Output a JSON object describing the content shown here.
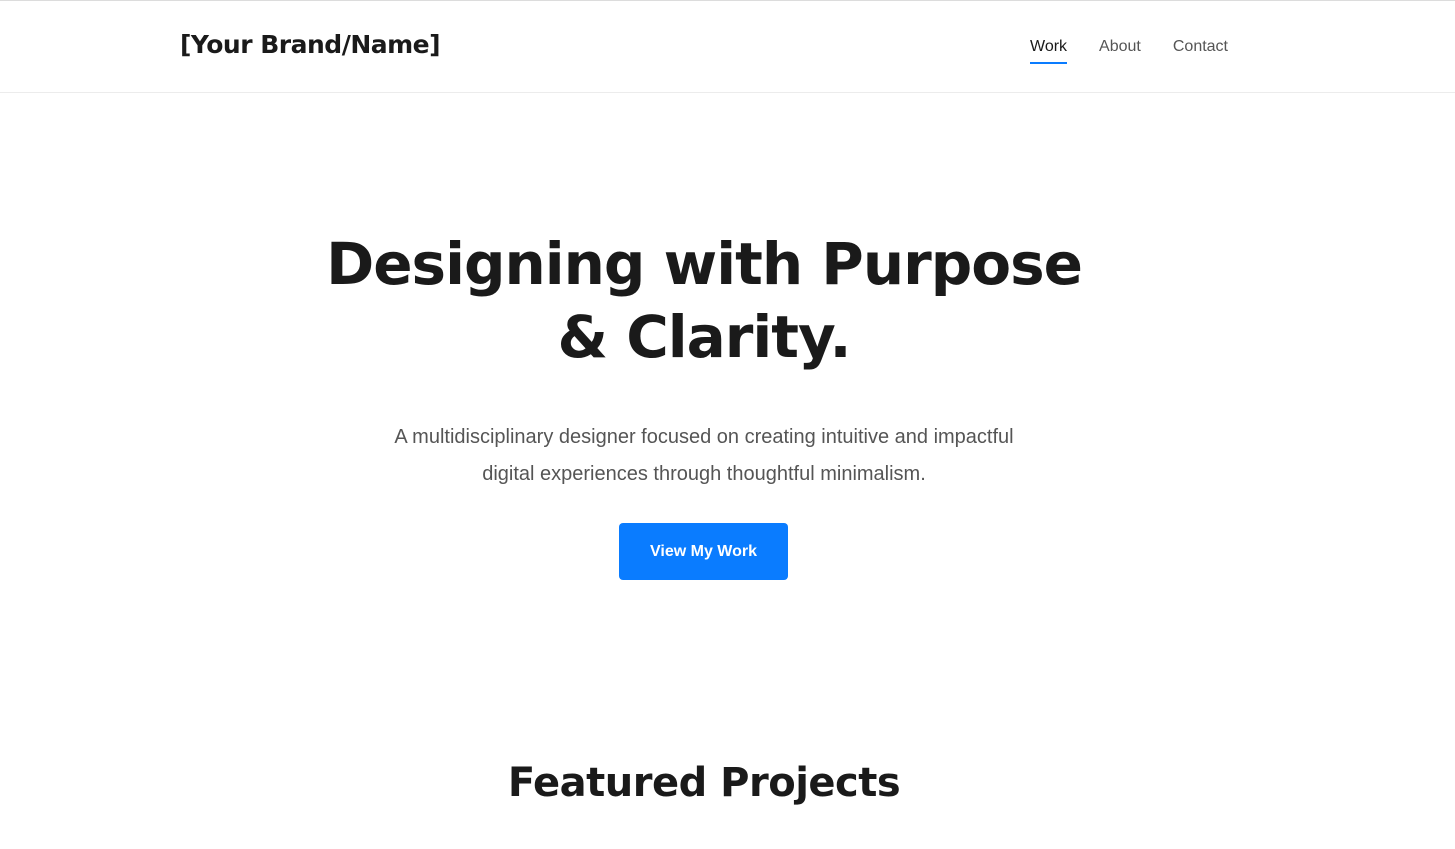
{
  "header": {
    "brand": "[Your Brand/Name]",
    "nav": [
      {
        "label": "Work",
        "active": true
      },
      {
        "label": "About",
        "active": false
      },
      {
        "label": "Contact",
        "active": false
      }
    ]
  },
  "hero": {
    "title_line1": "Designing with Purpose",
    "title_line2": "& Clarity.",
    "subtitle_line1": "A multidisciplinary designer focused on creating intuitive and impactful",
    "subtitle_line2": "digital experiences through thoughtful minimalism.",
    "cta_label": "View My Work"
  },
  "featured": {
    "title": "Featured Projects"
  },
  "colors": {
    "accent": "#0a7cff",
    "text_primary": "#1a1a1a",
    "text_secondary": "#555555",
    "background": "#ffffff"
  }
}
